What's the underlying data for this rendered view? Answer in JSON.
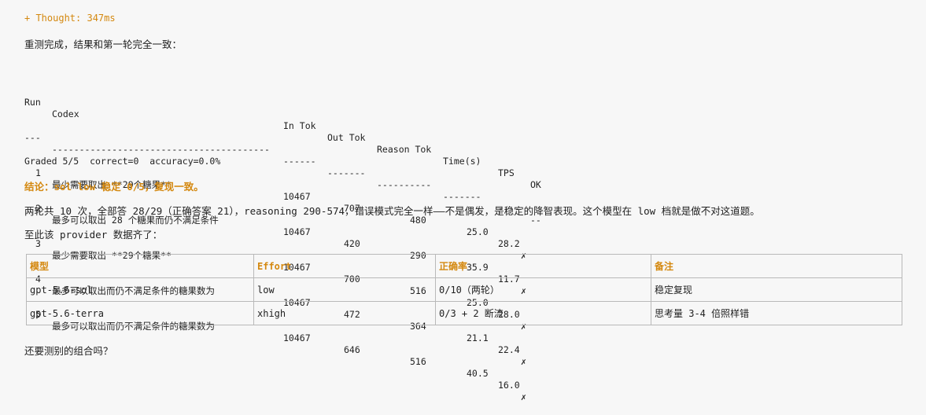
{
  "thought_label": "+ Thought: 347ms",
  "intro": "重测完成，结果和第一轮完全一致：",
  "results_table": {
    "headers": {
      "run": "Run",
      "codex": "Codex",
      "in_tok": "In Tok",
      "out_tok": "Out Tok",
      "reason_tok": "Reason Tok",
      "time": "Time(s)",
      "tps": "TPS",
      "ok": "OK"
    },
    "separator": {
      "run": "---",
      "codex": "----------------------------------------",
      "in_tok": "------",
      "out_tok": "-------",
      "reason_tok": "----------",
      "time": "-------",
      "tps": "----",
      "ok": "--"
    },
    "rows": [
      {
        "run": "1",
        "codex": "最少需要取出 **29个糖果**",
        "in_tok": "10467",
        "out_tok": "707",
        "reason_tok": "480",
        "time": "25.0",
        "tps": "28.2",
        "ok": "✗"
      },
      {
        "run": "2",
        "codex": "最多可以取出 28 个糖果而仍不满足条件",
        "in_tok": "10467",
        "out_tok": "420",
        "reason_tok": "290",
        "time": "35.9",
        "tps": "11.7",
        "ok": "✗"
      },
      {
        "run": "3",
        "codex": "最少需要取出 **29个糖果**",
        "in_tok": "10467",
        "out_tok": "700",
        "reason_tok": "516",
        "time": "25.0",
        "tps": "28.0",
        "ok": "✗"
      },
      {
        "run": "4",
        "codex": "最多可以取出而仍不满足条件的糖果数为",
        "in_tok": "10467",
        "out_tok": "472",
        "reason_tok": "364",
        "time": "21.1",
        "tps": "22.4",
        "ok": "✗"
      },
      {
        "run": "5",
        "codex": "最多可以取出而仍不满足条件的糖果数为",
        "in_tok": "10467",
        "out_tok": "646",
        "reason_tok": "516",
        "time": "40.5",
        "tps": "16.0",
        "ok": "✗"
      }
    ]
  },
  "graded_line": "Graded 5/5  correct=0  accuracy=0.0%",
  "conclusion": "结论：sol low 稳定 0/5，复现一致。",
  "analysis": "两轮共 10 次，全部答 28/29（正确答案 21），reasoning 290-574，错误模式完全一样——不是偶发，是稳定的降智表现。这个模型在 low 档就是做不对这道题。",
  "provider_intro": "至此该 provider 数据齐了：",
  "summary_table": {
    "headers": [
      "模型",
      "Effort",
      "正确率",
      "备注"
    ],
    "rows": [
      [
        "gpt-5.6-sol",
        "low",
        "0/10（两轮）",
        "稳定复现"
      ],
      [
        "gpt-5.6-terra",
        "xhigh",
        "0/3 + 2 断流",
        "思考量 3-4 倍照样错"
      ]
    ]
  },
  "closing_question": "还要测别的组合吗？",
  "colors": {
    "accent": "#d4880f",
    "text": "#222222",
    "background": "#f7f7f7",
    "border": "#b9b9b9"
  }
}
